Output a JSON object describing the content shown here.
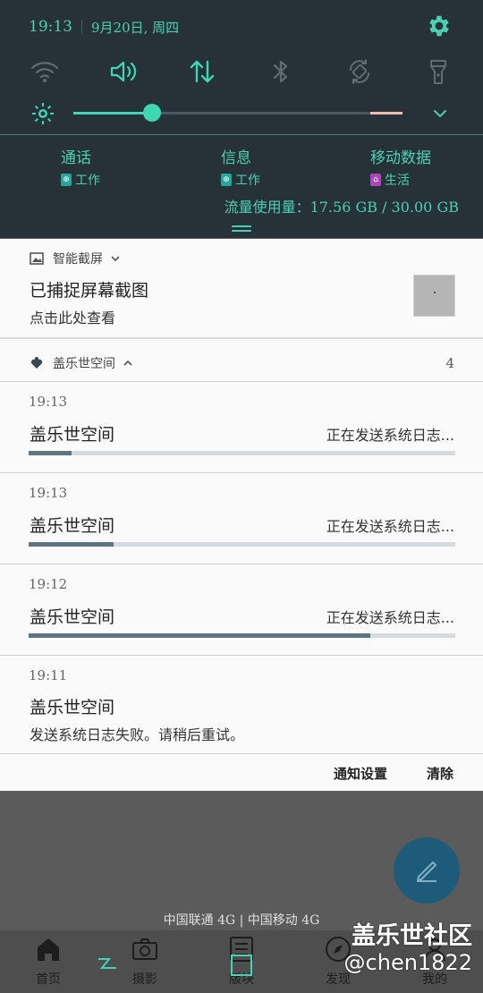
{
  "status_bar": {
    "time": "19:13",
    "date": "9月20日, 周四"
  },
  "quick_toggles": [
    {
      "icon": "wifi-icon",
      "active": false
    },
    {
      "icon": "sound-icon",
      "active": true
    },
    {
      "icon": "mobile-data-icon",
      "active": true
    },
    {
      "icon": "bluetooth-icon",
      "active": false
    },
    {
      "icon": "auto-rotate-icon",
      "active": false
    },
    {
      "icon": "flashlight-icon",
      "active": false
    }
  ],
  "brightness": {
    "level": 0.24
  },
  "sim": [
    {
      "title": "通话",
      "label": "工作",
      "badge_color": "#26a69a"
    },
    {
      "title": "信息",
      "label": "工作",
      "badge_color": "#26a69a"
    },
    {
      "title": "移动数据",
      "label": "生活",
      "badge_color": "#ab47bc"
    }
  ],
  "data_usage": "流量使用量：17.56 GB / 30.00 GB",
  "screenshot_notification": {
    "app": "智能截屏",
    "title": "已捕捉屏幕截图",
    "text": "点击此处查看"
  },
  "group": {
    "app": "盖乐世空间",
    "count": "4"
  },
  "notifications": [
    {
      "time": "19:13",
      "title": "盖乐世空间",
      "status": "正在发送系统日志...",
      "progress": 0.1
    },
    {
      "time": "19:13",
      "title": "盖乐世空间",
      "status": "正在发送系统日志...",
      "progress": 0.2
    },
    {
      "time": "19:12",
      "title": "盖乐世空间",
      "status": "正在发送系统日志...",
      "progress": 0.8
    },
    {
      "time": "19:11",
      "title": "盖乐世空间",
      "text": "发送系统日志失败。请稍后重试。"
    }
  ],
  "actions": {
    "settings": "通知设置",
    "clear": "清除"
  },
  "carrier": "中国联通 4G | 中国移动 4G",
  "nav": [
    {
      "label": "首页",
      "icon": "home-icon"
    },
    {
      "label": "摄影",
      "icon": "camera-icon"
    },
    {
      "label": "版块",
      "icon": "board-icon"
    },
    {
      "label": "发现",
      "icon": "compass-icon"
    },
    {
      "label": "我的",
      "icon": "profile-icon"
    }
  ],
  "watermark": {
    "line1": "盖乐世社区",
    "line2": "@chen1822"
  }
}
